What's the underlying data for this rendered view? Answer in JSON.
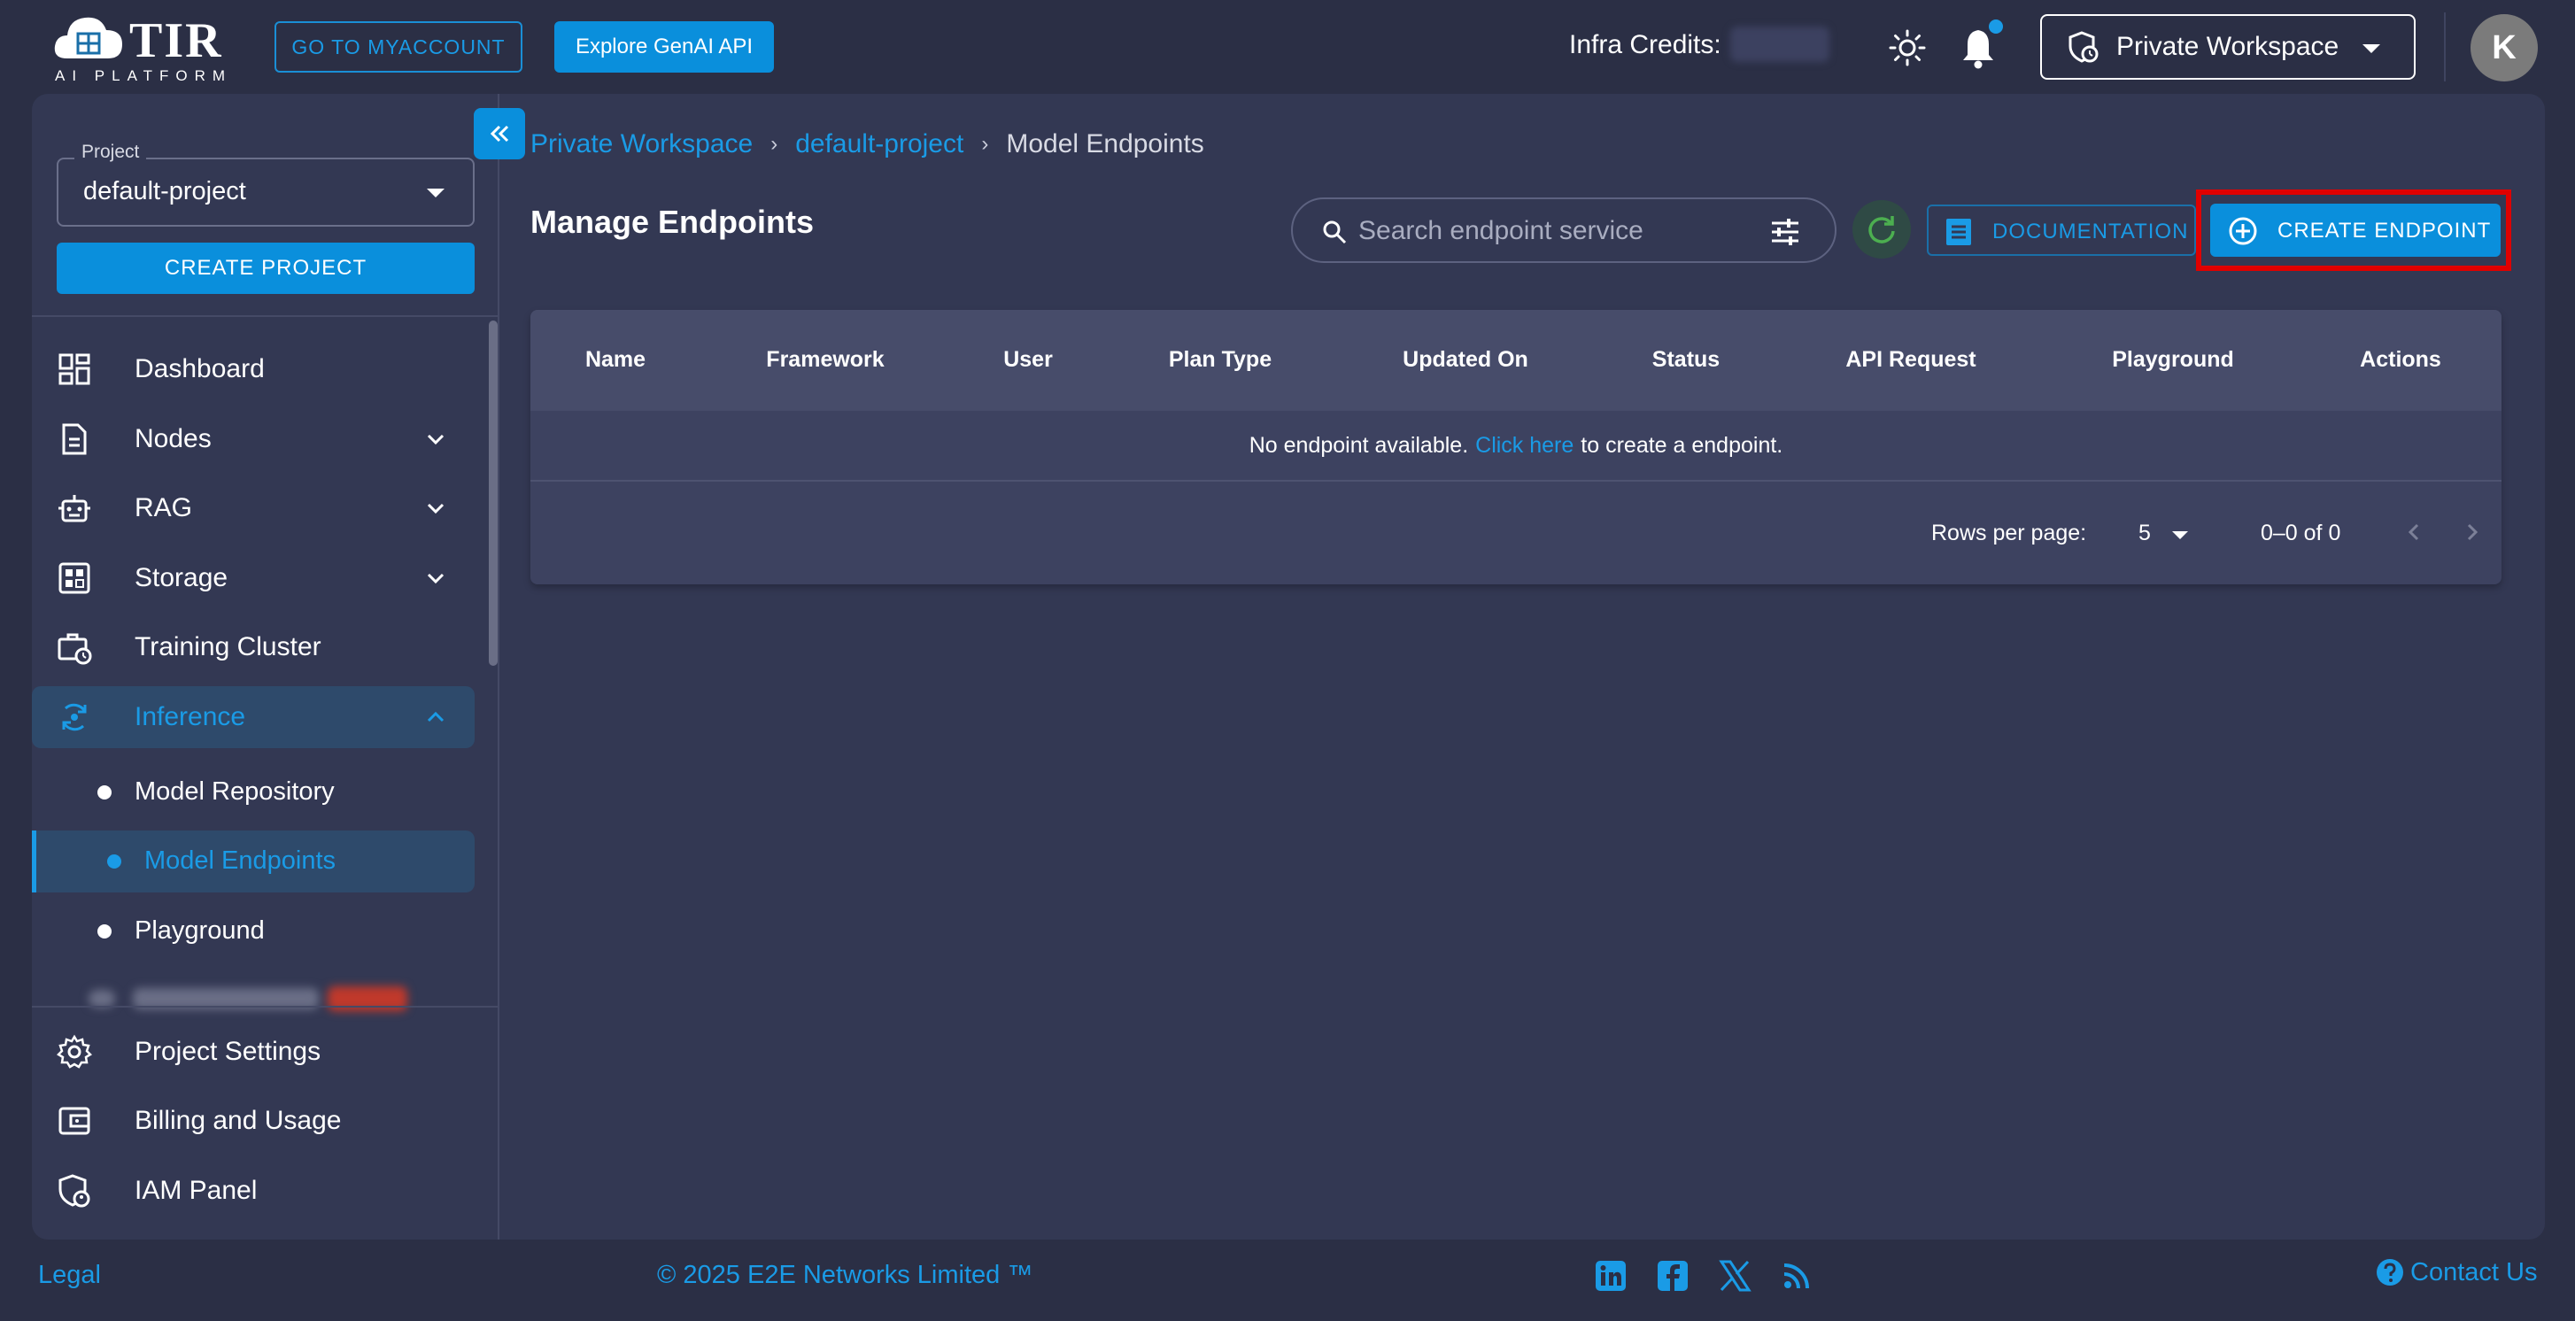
{
  "header": {
    "logo_text": "TIR",
    "logo_subtitle": "AI PLATFORM",
    "go_to_myaccount_label": "GO TO MYACCOUNT",
    "explore_genai_label": "Explore GenAI API",
    "infra_credits_label": "Infra Credits:",
    "workspace_label": "Private Workspace",
    "avatar_initial": "K",
    "notification_badge": true
  },
  "sidebar": {
    "project_legend": "Project",
    "project_value": "default-project",
    "create_project_label": "CREATE PROJECT",
    "items": [
      {
        "label": "Dashboard",
        "icon": "dashboard-icon"
      },
      {
        "label": "Nodes",
        "icon": "document-icon",
        "expandable": true
      },
      {
        "label": "RAG",
        "icon": "robot-icon",
        "expandable": true
      },
      {
        "label": "Storage",
        "icon": "storage-icon",
        "expandable": true
      },
      {
        "label": "Training Cluster",
        "icon": "briefcase-clock-icon"
      },
      {
        "label": "Inference",
        "icon": "inference-icon",
        "expandable": true,
        "expanded": true,
        "active": true
      }
    ],
    "subitems": [
      {
        "label": "Model Repository"
      },
      {
        "label": "Model Endpoints",
        "active": true
      },
      {
        "label": "Playground"
      }
    ],
    "bottom_items": [
      {
        "label": "Project Settings",
        "icon": "gear-icon"
      },
      {
        "label": "Billing and Usage",
        "icon": "wallet-icon"
      },
      {
        "label": "IAM Panel",
        "icon": "shield-user-icon"
      }
    ]
  },
  "breadcrumb": {
    "items": [
      "Private Workspace",
      "default-project",
      "Model Endpoints"
    ]
  },
  "main": {
    "title": "Manage Endpoints",
    "search_placeholder": "Search endpoint service",
    "documentation_label": "DOCUMENTATION",
    "create_endpoint_label": "CREATE ENDPOINT"
  },
  "table": {
    "columns": [
      "Name",
      "Framework",
      "User",
      "Plan Type",
      "Updated On",
      "Status",
      "API Request",
      "Playground",
      "Actions"
    ],
    "empty_prefix": "No endpoint available.",
    "empty_link": "Click here",
    "empty_suffix": "to create a endpoint.",
    "rows_per_page_label": "Rows per page:",
    "rows_per_page_value": "5",
    "range_text": "0–0 of 0"
  },
  "footer": {
    "legal": "Legal",
    "copyright": "© 2025 E2E Networks Limited ™",
    "social": [
      "linkedin-icon",
      "facebook-icon",
      "x-twitter-icon",
      "rss-icon"
    ],
    "contact": "Contact Us"
  },
  "colors": {
    "background": "#2b2f45",
    "panel": "#333853",
    "accent": "#0a8fdc",
    "link": "#1a9be6",
    "highlight": "#e00000"
  }
}
